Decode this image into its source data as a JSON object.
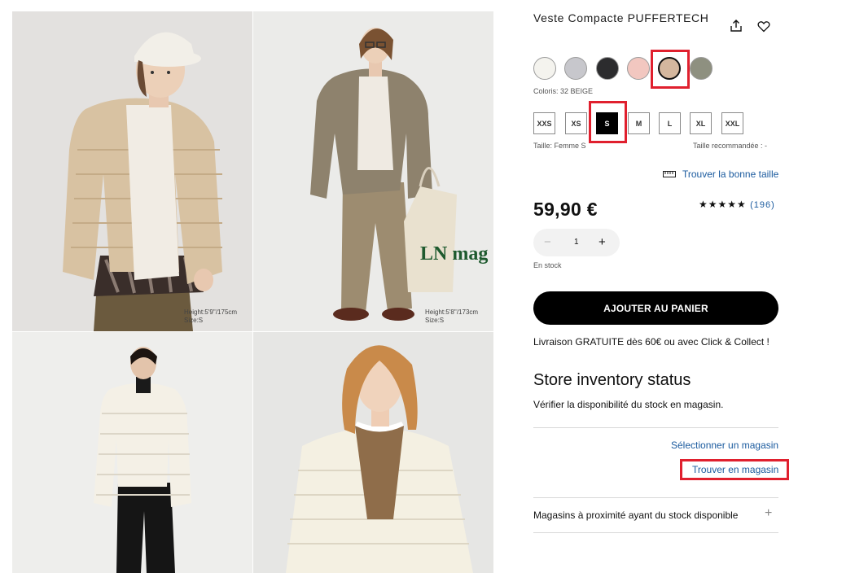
{
  "gallery": {
    "photos": [
      {
        "caption_height": "Height:5'9''/175cm",
        "caption_size": "Size:S"
      },
      {
        "caption_height": "Height:5'8''/173cm",
        "caption_size": "Size:S"
      },
      {},
      {}
    ],
    "tote_text": "LN mag"
  },
  "product": {
    "title": "Veste Compacte PUFFERTECH",
    "share_icon": "share-icon",
    "wishlist_icon": "heart-icon",
    "color_label": "Coloris: 32 BEIGE",
    "swatches": [
      {
        "name": "off-white",
        "color": "#f4f3ee"
      },
      {
        "name": "light-gray",
        "color": "#c7c7cc"
      },
      {
        "name": "black",
        "color": "#2c2c2e"
      },
      {
        "name": "pink",
        "color": "#f2c7c0"
      },
      {
        "name": "beige",
        "color": "#d4b79e"
      },
      {
        "name": "olive",
        "color": "#8e9080"
      }
    ],
    "sizes": [
      "XXS",
      "XS",
      "S",
      "M",
      "L",
      "XL",
      "XXL"
    ],
    "selected_size": "S",
    "size_label": "Taille: Femme S",
    "recommended_label": "Taille recommandée : -",
    "find_size": "Trouver la bonne taille",
    "price": "59,90 €",
    "stars": "★★★★★",
    "review_count": "(196)",
    "quantity": "1",
    "qty_minus": "−",
    "qty_plus": "+",
    "stock": "En stock",
    "add_to_cart": "AJOUTER AU PANIER",
    "delivery": "Livraison GRATUITE dès 60€ ou avec Click & Collect !"
  },
  "store": {
    "heading": "Store inventory status",
    "description": "Vérifier la disponibilité du stock en magasin.",
    "select_store": "Sélectionner un magasin",
    "find_in_store": "Trouver en magasin",
    "nearby": "Magasins à proximité ayant du stock disponible",
    "expand": "+"
  },
  "colors": {
    "highlight": "#e0202e",
    "link": "#1a5a9e",
    "button": "#000000"
  }
}
